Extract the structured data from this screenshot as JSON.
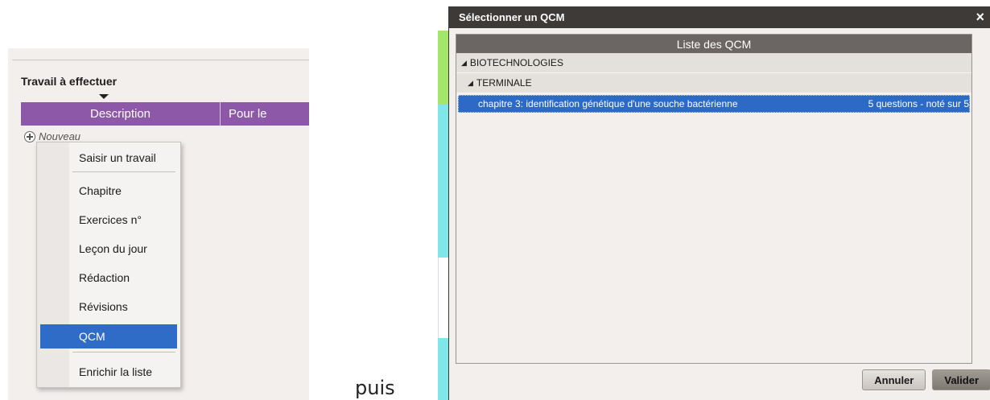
{
  "left_panel": {
    "title": "Travail à effectuer",
    "columns": [
      "Description",
      "Pour le"
    ],
    "new_row_label": "Nouveau"
  },
  "context_menu": {
    "items": [
      {
        "label": "Saisir un travail",
        "selected": false
      },
      {
        "label": "Chapitre",
        "selected": false
      },
      {
        "label": "Exercices n°",
        "selected": false
      },
      {
        "label": "Leçon du jour",
        "selected": false
      },
      {
        "label": "Rédaction",
        "selected": false
      },
      {
        "label": "Révisions",
        "selected": false
      },
      {
        "label": "QCM",
        "selected": true
      },
      {
        "label": "Enrichir la liste",
        "selected": false
      }
    ]
  },
  "connector_text": "puis",
  "dialog": {
    "title": "Sélectionner un QCM",
    "close_symbol": "×",
    "list_header": "Liste des QCM",
    "groups": [
      {
        "label": "BIOTECHNOLOGIES"
      },
      {
        "label": "TERMINALE"
      }
    ],
    "qcm_item": {
      "name": "chapitre 3: identification génétique d'une souche bactérienne",
      "meta": "5 questions - noté sur 5"
    },
    "buttons": {
      "cancel": "Annuler",
      "validate": "Valider"
    }
  },
  "colors": {
    "header_purple": "#8e58a8",
    "selection_blue": "#2f6cc7",
    "titlebar_dark": "#3e3a38",
    "list_header_gray": "#6b6663"
  },
  "icons": {
    "new_row": "plus-circle-icon",
    "close": "close-icon",
    "sort": "sort-down-icon",
    "expand": "triangle-expanded-icon"
  }
}
